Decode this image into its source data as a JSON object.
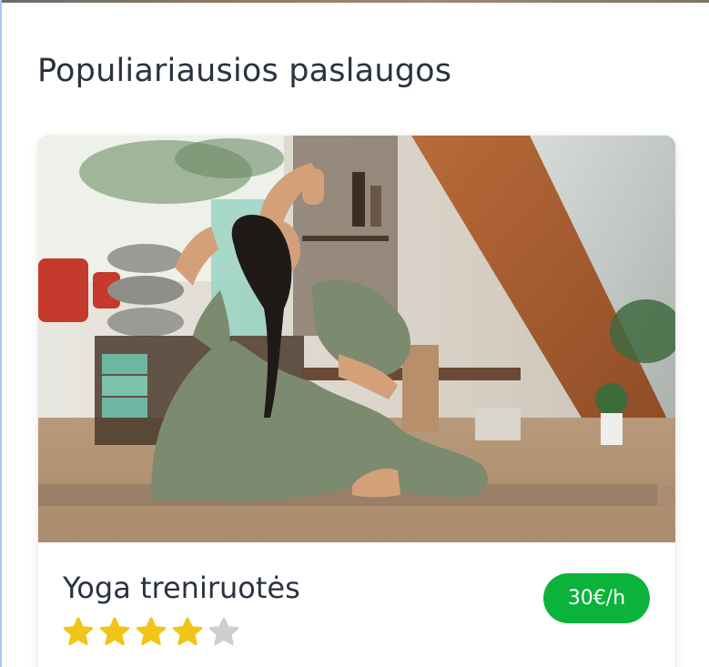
{
  "section": {
    "title": "Populiariausios paslaugos"
  },
  "service_card": {
    "image_icon": "yoga-photo",
    "title": "Yoga treniruotės",
    "price": "30€/h",
    "rating": 4,
    "rating_max": 5,
    "colors": {
      "price_badge": "#0bb33b",
      "star_filled": "#f0c419",
      "star_empty": "#cfcfcf",
      "title_text": "#2b3240"
    }
  }
}
